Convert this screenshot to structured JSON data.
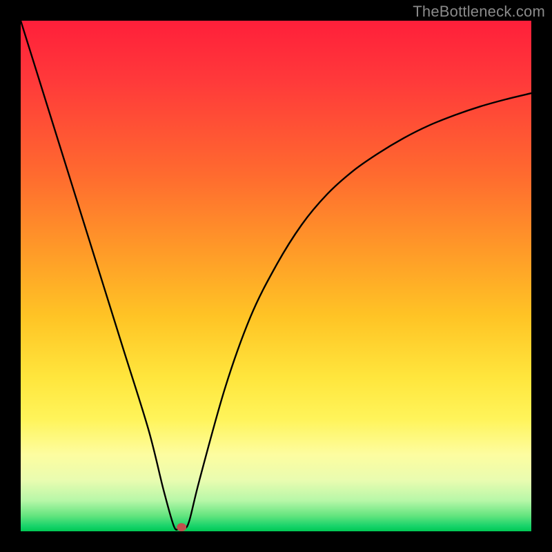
{
  "watermark": "TheBottleneck.com",
  "chart_data": {
    "type": "line",
    "title": "",
    "xlabel": "",
    "ylabel": "",
    "xlim": [
      0,
      100
    ],
    "ylim": [
      0,
      100
    ],
    "series": [
      {
        "name": "bottleneck-curve",
        "x": [
          0,
          5,
          10,
          15,
          20,
          25,
          28,
          30,
          31,
          32,
          33,
          35,
          40,
          45,
          50,
          55,
          60,
          65,
          70,
          75,
          80,
          85,
          90,
          95,
          100
        ],
        "values": [
          100,
          84,
          68,
          52,
          36,
          20,
          8,
          1,
          0.5,
          0.5,
          2,
          10,
          28,
          42,
          52,
          60,
          66,
          70.5,
          74,
          77,
          79.5,
          81.5,
          83.2,
          84.6,
          85.8
        ]
      }
    ],
    "marker": {
      "x": 31.5,
      "y": 0.8,
      "color": "#c0504d"
    },
    "gradient_stops": [
      {
        "pos": 0,
        "color": "#ff1f3a"
      },
      {
        "pos": 30,
        "color": "#ff6a2f"
      },
      {
        "pos": 58,
        "color": "#ffc425"
      },
      {
        "pos": 85,
        "color": "#fdfda0"
      },
      {
        "pos": 100,
        "color": "#00c853"
      }
    ]
  }
}
